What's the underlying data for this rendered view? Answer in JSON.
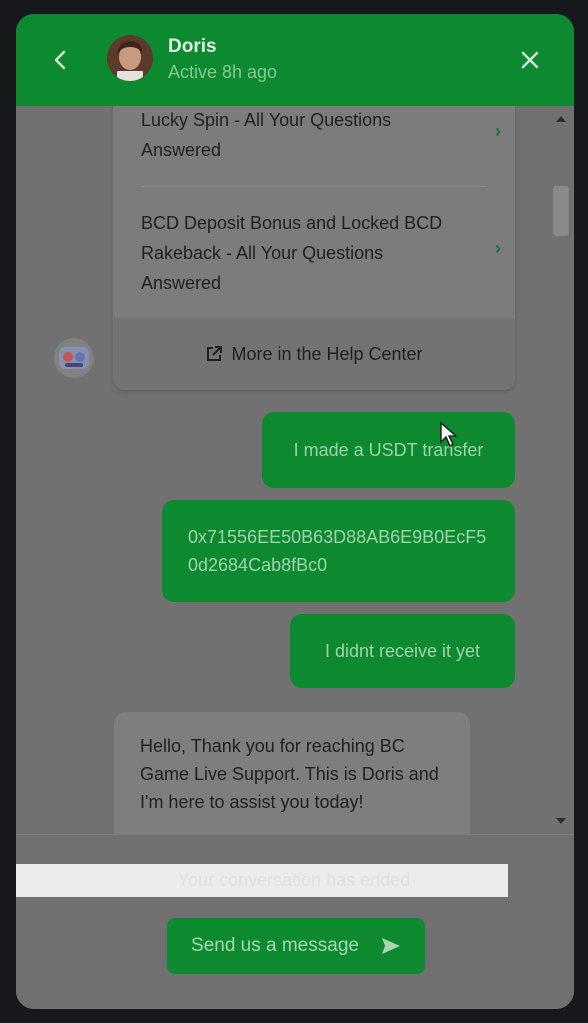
{
  "header": {
    "agent_name": "Doris",
    "agent_status": "Active 8h ago",
    "back_icon": "chevron-left-icon",
    "close_icon": "close-icon"
  },
  "help_center": {
    "articles": [
      {
        "title": "Lucky Spin - All Your Questions Answered"
      },
      {
        "title": "BCD Deposit Bonus and Locked BCD Rakeback - All Your Questions Answered"
      }
    ],
    "more_label": "More in the Help Center"
  },
  "messages": [
    {
      "direction": "out",
      "text": "I made a USDT transfer"
    },
    {
      "direction": "out",
      "text": "0x71556EE50B63D88AB6E9B0EcF50d2684Cab8fBc0"
    },
    {
      "direction": "out",
      "text": "I didnt receive it yet"
    },
    {
      "direction": "in",
      "text": "Hello, Thank you for reaching BC Game Live Support. This is Doris and I'm here to assist you today!"
    }
  ],
  "footer": {
    "ended_text": "Your conversation has ended",
    "send_label": "Send us a message"
  },
  "colors": {
    "brand_green": "#0d8a2f",
    "overlay_gray": "#707170"
  }
}
